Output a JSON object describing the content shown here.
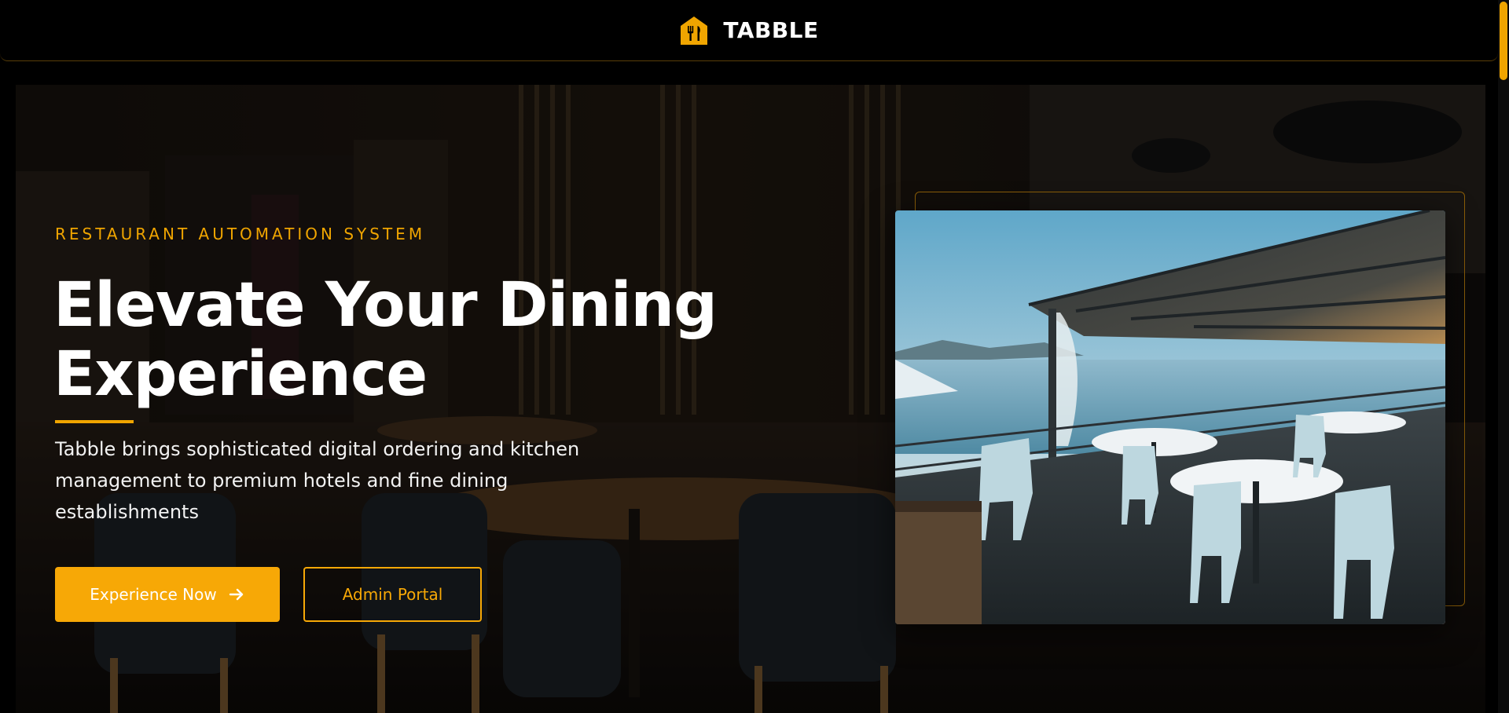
{
  "header": {
    "brand": "TABBLE",
    "logo_icon": "restaurant-house-cutlery-icon",
    "accent_color": "#f0a500"
  },
  "hero": {
    "eyebrow": "RESTAURANT AUTOMATION SYSTEM",
    "headline_line1": "Elevate Your Dining",
    "headline_line2": "Experience",
    "description": "Tabble brings sophisticated digital ordering and kitchen management to premium hotels and fine dining establishments",
    "primary_button": "Experience Now",
    "primary_button_icon": "arrow-right-icon",
    "secondary_button": "Admin Portal"
  },
  "colors": {
    "background": "#000000",
    "accent": "#f7a806",
    "text": "#ffffff"
  }
}
